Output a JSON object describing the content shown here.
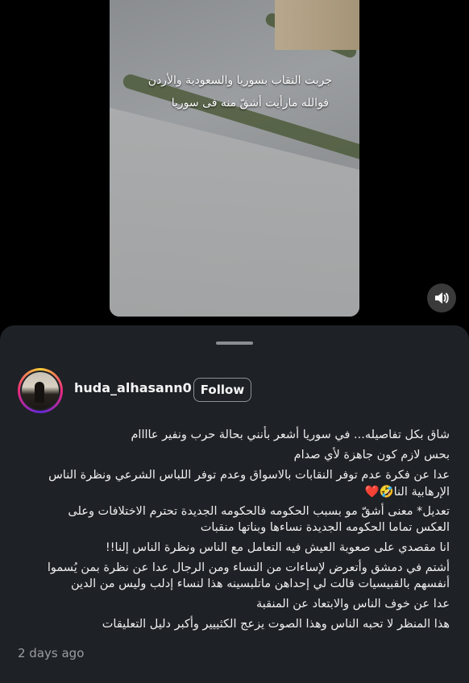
{
  "video": {
    "overlay_lines": [
      "جربت النقاب بسوريا والسعودية والأردن",
      "فوالله مارأيت أشقّ منه فى سوريا"
    ]
  },
  "volume_icon": "speaker-icon",
  "post": {
    "username": "huda_alhasann0",
    "follow_label": "Follow",
    "caption_lines": [
      "شاق بكل تفاصيله... في سوريا أشعر بأنني بحالة حرب ونفير عاااام",
      "بحس لازم كون جاهزة لأي صدام",
      "عدا عن فكرة عدم توفر النقابات بالاسواق وعدم توفر اللباس الشرعي ونظرة الناس",
      "الإرهابية النا🤣",
      "تعديل* معنى أشقّ مو بسبب الحكومه فالحكومه الجديدة تحترم الاختلافات وعلى",
      "العكس تماما الحكومه الجديدة نساءها وبناتها منقبات",
      "انا مقصدي على صعوبة العيش فيه التعامل مع الناس ونظرة الناس إلنا!!",
      "أشتم في دمشق وأتعرض لإساءات من النساء ومن الرجال عدا عن نظرة بمن يُسموا",
      "أنفسهم بالقبيسيات قالت لي إحداهن ماتلبسينه هذا لنساء إدلب وليس من الدين",
      "عدا عن خوف الناس والابتعاد عن المنقبة",
      "هذا المنظر لا تحبه الناس وهذا الصوت يزعج الكثييير وأكبر دليل التعليقات"
    ],
    "heart": "❤️",
    "timestamp": "2 days ago"
  }
}
